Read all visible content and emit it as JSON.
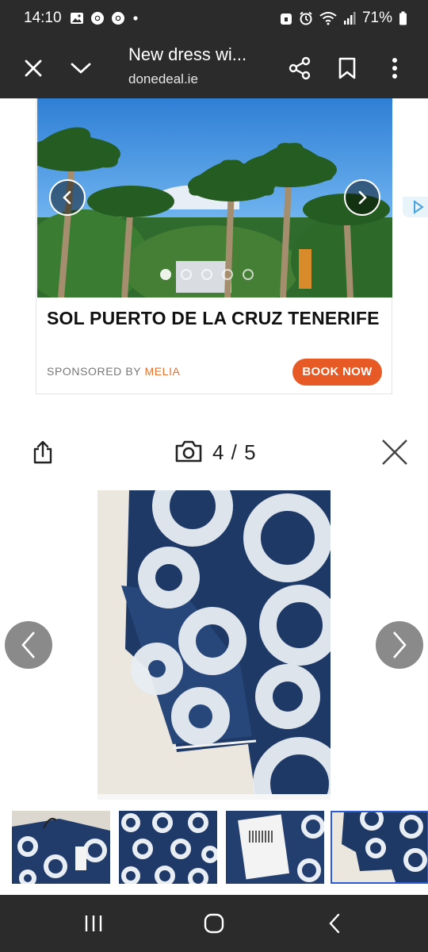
{
  "status": {
    "time": "14:10",
    "battery": "71%",
    "left_icons": [
      "gallery-icon",
      "chrome-icon",
      "chrome-icon",
      "dot-icon"
    ],
    "right_icons": [
      "alarm-lock-icon",
      "alarm-clock-icon",
      "wifi-icon",
      "signal-icon",
      "battery-icon"
    ]
  },
  "toolbar": {
    "title": "New dress wi...",
    "url": "donedeal.ie",
    "icons": [
      "close-icon",
      "chevron-down-icon",
      "share-icon",
      "bookmark-icon",
      "more-vert-icon"
    ]
  },
  "ad": {
    "title": "SOL PUERTO DE LA CRUZ TENERIFE",
    "sponsored_by": "SPONSORED BY",
    "brand": "MELIA",
    "cta": "BOOK NOW",
    "slide_count": 5,
    "active_slide": 1,
    "brand_color": "#e8712c",
    "cta_color": "#e85a25"
  },
  "viewer": {
    "counter": "4 / 5",
    "icons": [
      "share-out-icon",
      "camera-icon",
      "close-icon"
    ]
  },
  "thumbnails": {
    "count": 4,
    "selected_index": 3,
    "selected_border_color": "#2d5bd8"
  },
  "navbar": {
    "icons": [
      "recents-icon",
      "home-icon",
      "back-icon"
    ]
  }
}
